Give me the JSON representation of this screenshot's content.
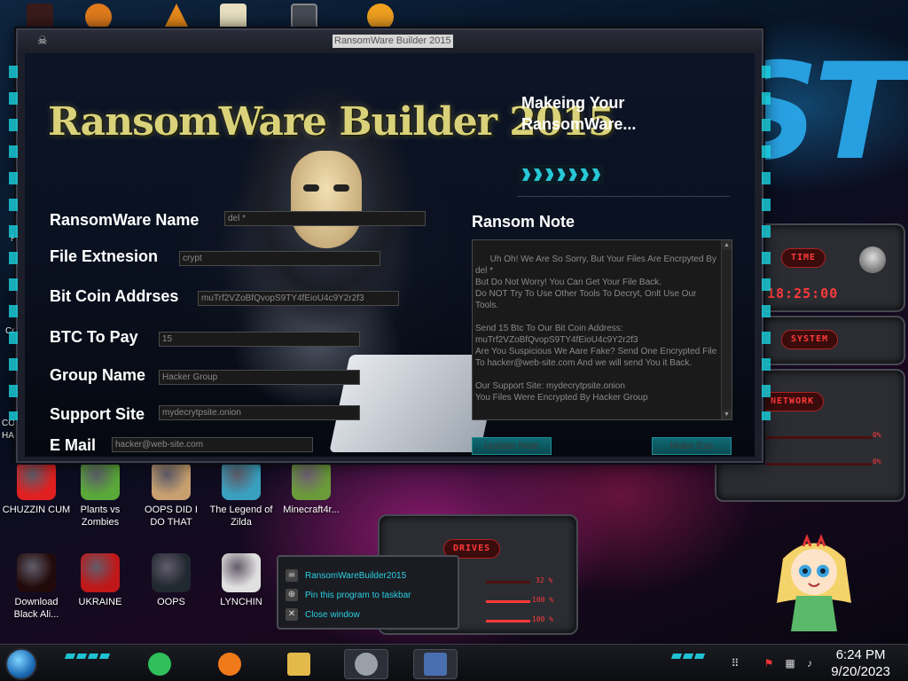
{
  "window": {
    "title": "RansomWare Builder 2015",
    "app_heading": "RansomWare Builder 2015",
    "status": "Makeing Your RansomWare..."
  },
  "progress": {
    "fraction": 0.7
  },
  "form": {
    "fields": [
      {
        "label": "RansomWare Name",
        "value": "del *"
      },
      {
        "label": "File Extnesion",
        "value": "crypt"
      },
      {
        "label": "Bit Coin Addrses",
        "value": "muTrf2VZoBfQvopS9TY4fEioU4c9Y2r2f3"
      },
      {
        "label": "BTC To Pay",
        "value": "15"
      },
      {
        "label": "Group Name",
        "value": "Hacker Group"
      },
      {
        "label": "Support Site",
        "value": "mydecrytpsite.onion"
      },
      {
        "label": "E Mail",
        "value": "hacker@web-site.com"
      }
    ],
    "note_label": "Ransom Note",
    "note_text": "Uh Oh! We Are So Sorry, But Your Files Are Encrpyted By del *\nBut Do Not Worry! You Can Get Your File Back.\nDo NOT Try To Use Other Tools To Decryt, Onlt Use Our Tools.\n\nSend 15 Btc To Our Bit Coin Address:\nmuTrf2VZoBfQvopS9TY4fEioU4c9Y2r2f3\nAre You Suspicious We Aare Fake? Send One Encrypted File To hacker@web-site.com And we will send You it Back.\n\nOur Support Site: mydecrytpsite.onion\nYou Files Were Encrypted By Hacker Group",
    "update_button": "Update Note",
    "make_button": "Make Exe"
  },
  "gadgets": {
    "time_label": "TIME",
    "time_value": "18:25:00",
    "system_label": "SYSTEM",
    "network_label": "NETWORK",
    "network_pct_1": "0%",
    "network_pct_2": "0%",
    "drives_label": "DRIVES",
    "drive_pct_1": "32 %",
    "drive_pct_2": "100 %",
    "drive_pct_3": "100 %"
  },
  "desktop_icons": [
    {
      "label": "CHUZZIN CUM",
      "icon": "chuzzle-icon"
    },
    {
      "label": "Plants vs Zombies",
      "icon": "plants-vs-zombies-icon"
    },
    {
      "label": "OOPS DID I DO THAT",
      "icon": "portrait-icon"
    },
    {
      "label": "The Legend of Zilda",
      "icon": "zelda-icon"
    },
    {
      "label": "Minecraft4r...",
      "icon": "minecraft-icon"
    },
    {
      "label": "Download Black Ali...",
      "icon": "black-orb-icon"
    },
    {
      "label": "UKRAINE",
      "icon": "radiation-icon"
    },
    {
      "label": "OOPS",
      "icon": "oops-icon"
    },
    {
      "label": "LYNCHIN",
      "icon": "lynchin-icon"
    }
  ],
  "edge_labels": {
    "left_1": "Re",
    "left_2": "Co",
    "left_3": "CO",
    "left_4": "HA"
  },
  "jumplist": {
    "items": [
      {
        "label": "RansomWareBuilder2015",
        "icon": "skull-app-icon"
      },
      {
        "label": "Pin this program to taskbar",
        "icon": "pin-icon"
      },
      {
        "label": "Close window",
        "icon": "close-icon"
      }
    ]
  },
  "taskbar": {
    "apps": [
      {
        "icon": "green-app-icon",
        "color": "#2fbf5b"
      },
      {
        "icon": "firefox-icon",
        "color": "#f07a1a"
      },
      {
        "icon": "file-explorer-icon",
        "color": "#e3b94a"
      },
      {
        "icon": "skull-app-icon",
        "color": "#9aa0a8"
      },
      {
        "icon": "h2-app-icon",
        "color": "#4a6fb0"
      }
    ],
    "time": "6:24 PM",
    "date": "9/20/2023"
  },
  "colors": {
    "accent_cyan": "#1fc2d2",
    "heading_gold": "#d9d27a",
    "gadget_red": "#ff3a3a"
  }
}
